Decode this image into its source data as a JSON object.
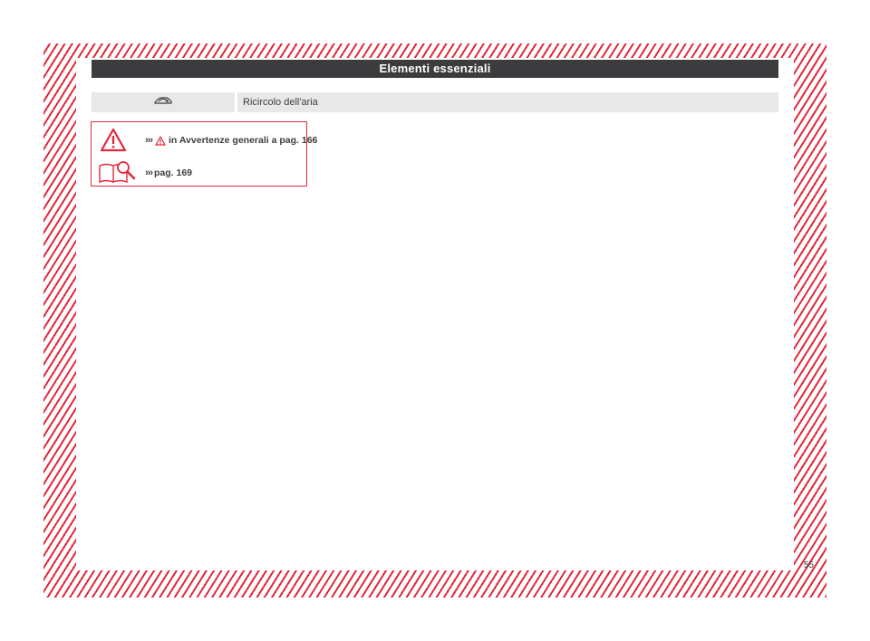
{
  "header": {
    "title": "Elementi essenziali"
  },
  "table": {
    "rows": [
      {
        "icon": "air-recirculation-icon",
        "label": "Ricircolo dell'aria"
      }
    ]
  },
  "reference_box": {
    "warning_icon": "warning-triangle-icon",
    "book_icon": "manual-book-magnifier-icon",
    "warning_ref": {
      "prefix": "›››",
      "text": "in Avvertenze generali a pag. 166"
    },
    "page_ref": {
      "prefix": "›››",
      "text": "pag. 169"
    }
  },
  "footer": {
    "page_number": "55"
  },
  "colors": {
    "accent_red": "#e3283a",
    "header_bg": "#3c3c3e",
    "row_bg": "#e8e8e8",
    "text": "#3c3c3e"
  }
}
